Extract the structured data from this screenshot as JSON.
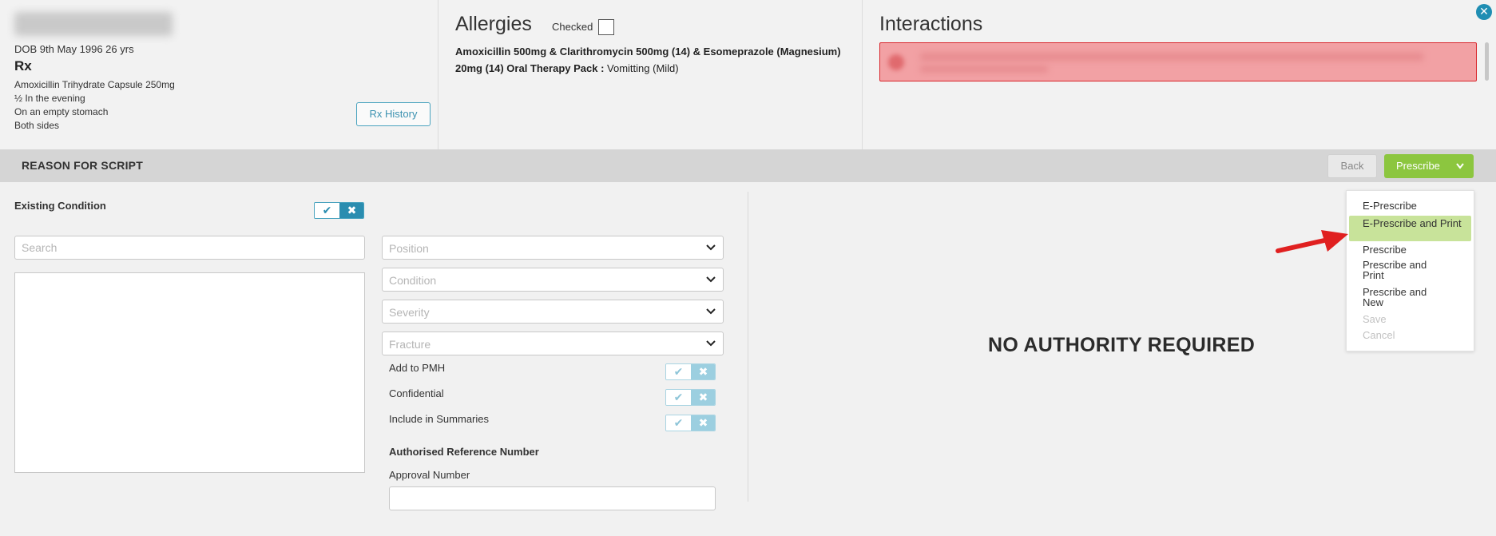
{
  "patient": {
    "dob": "DOB 9th May 1996 26 yrs",
    "rx_title": "Rx",
    "rx_lines": [
      "Amoxicillin Trihydrate Capsule 250mg",
      "½ In the evening",
      "On an empty stomach",
      "Both sides"
    ],
    "rx_history_label": "Rx History"
  },
  "allergies": {
    "title": "Allergies",
    "checked_label": "Checked",
    "checked": false,
    "item_name": "Amoxicillin 500mg & Clarithromycin 500mg (14) & Esomeprazole (Magnesium) 20mg (14) Oral Therapy Pack :",
    "item_reaction": " Vomitting (Mild)"
  },
  "interactions": {
    "title": "Interactions",
    "alert_color": "#f2a1a4",
    "close_label": "✕"
  },
  "reason_bar": {
    "title": "REASON FOR SCRIPT",
    "back_label": "Back",
    "prescribe_label": "Prescribe",
    "prescribe_color": "#8cc63f"
  },
  "prescribe_menu": {
    "items": [
      {
        "label": "E-Prescribe",
        "state": "normal"
      },
      {
        "label": "E-Prescribe and Print",
        "state": "highlighted"
      },
      {
        "label": "Prescribe",
        "state": "normal"
      },
      {
        "label": "Prescribe and Print",
        "state": "normal"
      },
      {
        "label": "Prescribe and New",
        "state": "normal"
      },
      {
        "label": "Save",
        "state": "disabled"
      },
      {
        "label": "Cancel",
        "state": "disabled"
      }
    ],
    "highlight_color": "#c8e39a"
  },
  "form": {
    "existing_condition_label": "Existing Condition",
    "search_placeholder": "Search",
    "selects": {
      "position": "Position",
      "condition": "Condition",
      "severity": "Severity",
      "fracture": "Fracture"
    },
    "options": {
      "add_to_pmh": "Add to PMH",
      "confidential": "Confidential",
      "include_in_summaries": "Include in Summaries"
    },
    "authorised_label": "Authorised Reference Number",
    "approval_label": "Approval Number",
    "approval_value": ""
  },
  "authority": {
    "status_text": "NO AUTHORITY REQUIRED"
  }
}
